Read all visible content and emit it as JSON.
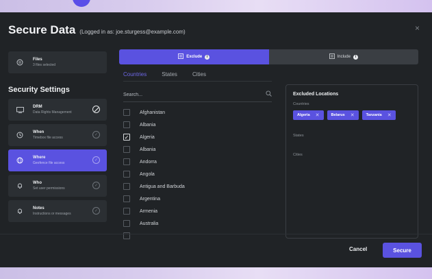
{
  "modal": {
    "title": "Secure Data",
    "subtitle": "(Logged in as: joe.sturgess@example.com)",
    "close": "×"
  },
  "files": {
    "title": "Files",
    "subtitle": "3 files selected",
    "icon": "file-icon"
  },
  "security_settings": {
    "heading": "Security Settings",
    "items": [
      {
        "title": "DRM",
        "subtitle": "Data Rights Management",
        "icon": "drm-icon",
        "status": "none"
      },
      {
        "title": "When",
        "subtitle": "Timebox file access",
        "icon": "clock-icon",
        "status": "check"
      },
      {
        "title": "Where",
        "subtitle": "Geofence file access",
        "icon": "globe-icon",
        "status": "check",
        "active": true
      },
      {
        "title": "Who",
        "subtitle": "Set user permissions",
        "icon": "bell-icon",
        "status": "check"
      },
      {
        "title": "Notes",
        "subtitle": "Instructions or messages",
        "icon": "bell-icon",
        "status": "check"
      }
    ]
  },
  "mode_toggle": {
    "exclude": "Exclude",
    "include": "Include",
    "selected": "exclude"
  },
  "tabs": [
    "Countries",
    "States",
    "Cities"
  ],
  "active_tab": "Countries",
  "search": {
    "placeholder": "Search...",
    "value": ""
  },
  "countries": [
    {
      "name": "Afghanistan",
      "checked": false
    },
    {
      "name": "Albania",
      "checked": false
    },
    {
      "name": "Algeria",
      "checked": true
    },
    {
      "name": "Albania",
      "checked": false
    },
    {
      "name": "Andorra",
      "checked": false
    },
    {
      "name": "Angola",
      "checked": false
    },
    {
      "name": "Antigua and Barbuda",
      "checked": false
    },
    {
      "name": "Argentina",
      "checked": false
    },
    {
      "name": "Armenia",
      "checked": false
    },
    {
      "name": "Australia",
      "checked": false
    }
  ],
  "excluded": {
    "title": "Excluded Locations",
    "countries_label": "Countries",
    "countries": [
      "Algeria",
      "Belarus",
      "Tanzania"
    ],
    "states_label": "States",
    "cities_label": "Cities"
  },
  "footer": {
    "cancel": "Cancel",
    "secure": "Secure"
  },
  "colors": {
    "accent": "#5a52e0",
    "panel": "#202326",
    "card": "#2b2f33"
  }
}
